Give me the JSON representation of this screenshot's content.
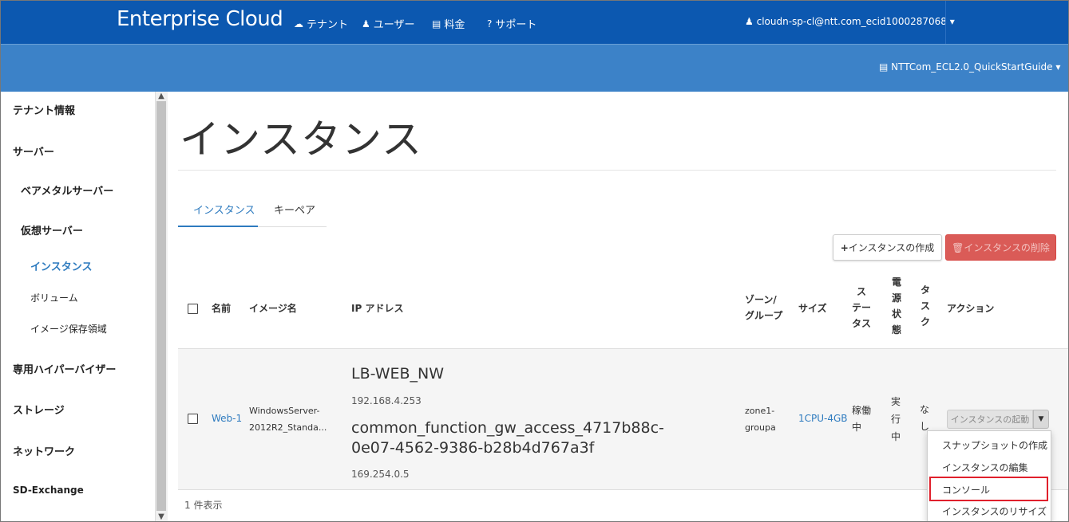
{
  "topbar": {
    "brand": "Enterprise Cloud",
    "nav": [
      {
        "icon": "cloud-icon",
        "label": "テナント"
      },
      {
        "icon": "user-icon",
        "label": "ユーザー"
      },
      {
        "icon": "credit-card-icon",
        "label": "料金"
      },
      {
        "icon": "question-circle-icon",
        "label": "サポート"
      }
    ],
    "user": "cloudn-sp-cl@ntt.com_ecid1000287068"
  },
  "subbar": {
    "project": "NTTCom_ECL2.0_QuickStartGuide"
  },
  "sidebar": {
    "items": [
      {
        "label": "テナント情報"
      },
      {
        "label": "サーバー"
      },
      {
        "label": "ベアメタルサーバー"
      },
      {
        "label": "仮想サーバー"
      },
      {
        "label": "インスタンス"
      },
      {
        "label": "ボリューム"
      },
      {
        "label": "イメージ保存領域"
      },
      {
        "label": "専用ハイパーバイザー"
      },
      {
        "label": "ストレージ"
      },
      {
        "label": "ネットワーク"
      },
      {
        "label": "SD-Exchange"
      }
    ]
  },
  "main": {
    "title": "インスタンス",
    "tabs": [
      {
        "label": "インスタンス"
      },
      {
        "label": "キーペア"
      }
    ],
    "buttons": {
      "create": "インスタンスの作成",
      "delete": "インスタンスの削除"
    },
    "table": {
      "headers": {
        "name": "名前",
        "image": "イメージ名",
        "ip": "IP アドレス",
        "zone": "ゾーン/ グループ",
        "zone_l1": "ゾーン/",
        "zone_l2": "グループ",
        "size": "サイズ",
        "status_chars": [
          "ス",
          "テー",
          "タス"
        ],
        "power_chars": [
          "電",
          "源",
          "状",
          "態"
        ],
        "task_chars": [
          "タ",
          "ス",
          "ク"
        ],
        "action": "アクション"
      },
      "rows": [
        {
          "name": "Web-1",
          "image_l1": "WindowsServer-",
          "image_l2": "2012R2_Standa...",
          "networks": [
            {
              "name": "LB-WEB_NW",
              "ip": "192.168.4.253"
            },
            {
              "name_l1": "common_function_gw_access_4717b88c-",
              "name_l2": "0e07-4562-9386-b28b4d767a3f",
              "ip": "169.254.0.5"
            }
          ],
          "zone_l1": "zone1-",
          "zone_l2": "groupa",
          "size": "1CPU-4GB",
          "status_l1": "稼働",
          "status_l2": "中",
          "power_chars": [
            "実",
            "行",
            "中"
          ],
          "task_l1": "な",
          "task_l2": "し",
          "action_button": "インスタンスの起動"
        }
      ],
      "count": "1 件表示"
    },
    "dropdown": [
      {
        "label": "スナップショットの作成"
      },
      {
        "label": "インスタンスの編集"
      },
      {
        "label": "コンソール"
      },
      {
        "label": "インスタンスのリサイズ"
      }
    ]
  }
}
